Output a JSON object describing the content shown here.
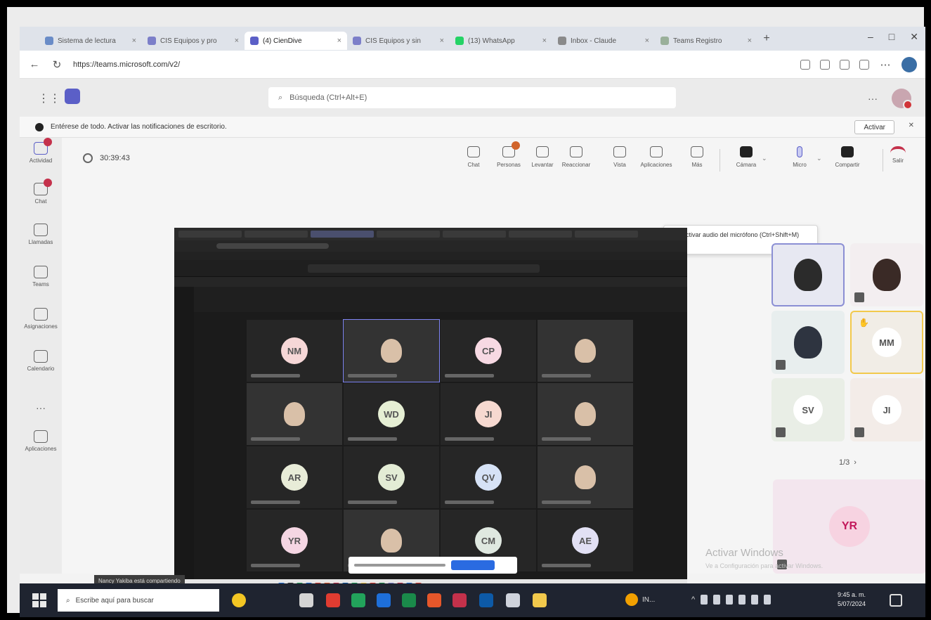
{
  "browser": {
    "tabs": [
      {
        "label": "Sistema de lectura",
        "icon": "document-icon",
        "color": "#6a8cc7"
      },
      {
        "label": "CIS Equipos y pro",
        "icon": "teams-icon",
        "color": "#7c7fc9"
      },
      {
        "label": "(4) CienDive",
        "icon": "teams-icon",
        "color": "#5b5fc7",
        "active": true
      },
      {
        "label": "CIS Equipos y sin",
        "icon": "teams-icon",
        "color": "#7c7fc9"
      },
      {
        "label": "(13) WhatsApp",
        "icon": "whatsapp-icon",
        "color": "#25d366"
      },
      {
        "label": "Inbox - Claude",
        "icon": "mail-icon",
        "color": "#8a8a8a"
      },
      {
        "label": "Teams Registro",
        "icon": "app-icon",
        "color": "#9ab09a"
      }
    ],
    "new_tab": "+",
    "window_controls": [
      "–",
      "□",
      "✕"
    ],
    "url": "https://teams.microsoft.com/v2/"
  },
  "teams": {
    "search_placeholder": "Búsqueda (Ctrl+Alt+E)",
    "more": "···",
    "banner_text": "Entérese de todo. Activar las notificaciones de escritorio.",
    "banner_button": "Activar",
    "banner_close": "✕"
  },
  "rail": [
    {
      "label": "Actividad",
      "badge": true,
      "active": true
    },
    {
      "label": "Chat",
      "badge": true
    },
    {
      "label": "Llamadas"
    },
    {
      "label": "Teams"
    },
    {
      "label": "Asignaciones"
    },
    {
      "label": "Calendario"
    },
    {
      "label": "···"
    },
    {
      "label": "Aplicaciones"
    }
  ],
  "meeting": {
    "timer": "30:39:43",
    "controls": [
      {
        "label": "Chat",
        "icon": "chat-icon"
      },
      {
        "label": "Personas",
        "icon": "people-icon",
        "badge": true
      },
      {
        "label": "Levantar",
        "icon": "raise-hand-icon"
      },
      {
        "label": "Reaccionar",
        "icon": "react-icon"
      },
      {
        "label": "Vista",
        "icon": "view-icon"
      },
      {
        "label": "Aplicaciones",
        "icon": "apps-icon"
      },
      {
        "label": "Más",
        "icon": "more-icon"
      },
      {
        "label": "Cámara",
        "icon": "camera-icon",
        "dark": true
      },
      {
        "label": "Micro",
        "icon": "mic-icon"
      },
      {
        "label": "Compartir",
        "icon": "share-icon",
        "dark": true
      },
      {
        "label": "Salir",
        "icon": "leave-icon"
      }
    ],
    "tooltip": "Desactivar audio del micrófono (Ctrl+Shift+M)"
  },
  "shared_screen": {
    "sharer": "Nancy Yakiba está compartiendo",
    "tiles": [
      {
        "initials": "NM",
        "color": "#f6d7d7"
      },
      {
        "photo": true,
        "selected": true
      },
      {
        "initials": "CP",
        "color": "#f7d9e3"
      },
      {
        "photo": true
      },
      {
        "photo": true
      },
      {
        "initials": "WD",
        "color": "#e6efd4"
      },
      {
        "initials": "JI",
        "color": "#f6d9d0"
      },
      {
        "photo": true
      },
      {
        "initials": "AR",
        "color": "#e8ecd8"
      },
      {
        "initials": "SV",
        "color": "#e3ecd5"
      },
      {
        "initials": "QV",
        "color": "#d6e2f6"
      },
      {
        "photo": true
      },
      {
        "initials": "YR",
        "color": "#f5d6e3"
      },
      {
        "photo": true
      },
      {
        "initials": "CM",
        "color": "#dfe8e0"
      },
      {
        "initials": "AE",
        "color": "#e2e0f4"
      }
    ]
  },
  "gallery": {
    "tiles": [
      {
        "type": "photo",
        "bg": "#e7e8f2",
        "selected": true,
        "muted": false
      },
      {
        "type": "photo",
        "bg": "#f3eef0",
        "muted": true
      },
      {
        "type": "photo",
        "bg": "#e8eeee",
        "muted": true
      },
      {
        "initials": "MM",
        "bg": "#f1ede6",
        "speaking": true,
        "hand": true
      },
      {
        "initials": "SV",
        "bg": "#e9eee6",
        "muted": true
      },
      {
        "initials": "JI",
        "bg": "#f3ece8",
        "muted": true
      }
    ],
    "pager": "1/3",
    "pager_next": "›",
    "spotlight_initials": "YR"
  },
  "watermark": {
    "title": "Activar Windows",
    "subtitle": "Ve a Configuración para activar Windows."
  },
  "taskbar": {
    "search_placeholder": "Escribe aquí para buscar",
    "apps_colors": [
      "#d4d4d4",
      "#e03c31",
      "#22a35b",
      "#1e6fd9",
      "#1a8a4a",
      "#e6572a",
      "#c4314b",
      "#0d5aa7",
      "#cfd3dc",
      "#f2c94c"
    ],
    "edge_label": "IN...",
    "time": "9:45 a. m.",
    "date": "5/07/2024"
  }
}
